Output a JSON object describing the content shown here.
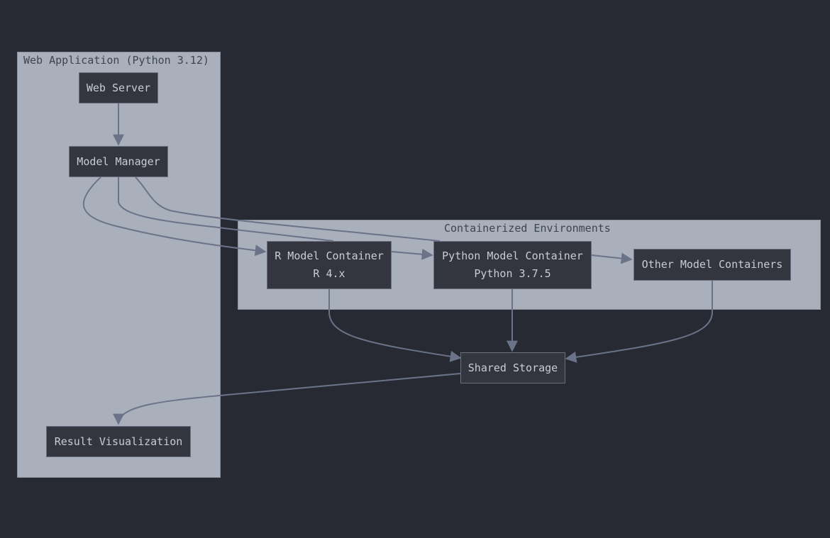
{
  "clusters": {
    "web_app": {
      "label": "Web Application (Python 3.12)"
    },
    "containers": {
      "label": "Containerized Environments"
    }
  },
  "nodes": {
    "web_server": {
      "label": "Web Server"
    },
    "model_manager": {
      "label": "Model Manager"
    },
    "r_container": {
      "label": "R Model Container",
      "sub": "R 4.x"
    },
    "python_container": {
      "label": "Python Model Container",
      "sub": "Python 3.7.5"
    },
    "other_containers": {
      "label": "Other Model Containers"
    },
    "shared_storage": {
      "label": "Shared Storage"
    },
    "result_viz": {
      "label": "Result Visualization"
    }
  },
  "edges": [
    {
      "from": "Web Server",
      "to": "Model Manager"
    },
    {
      "from": "Model Manager",
      "to": "R Model Container"
    },
    {
      "from": "Model Manager",
      "to": "Python Model Container"
    },
    {
      "from": "Model Manager",
      "to": "Other Model Containers"
    },
    {
      "from": "R Model Container",
      "to": "Python Model Container"
    },
    {
      "from": "Python Model Container",
      "to": "Other Model Containers"
    },
    {
      "from": "R Model Container",
      "to": "Shared Storage"
    },
    {
      "from": "Python Model Container",
      "to": "Shared Storage"
    },
    {
      "from": "Other Model Containers",
      "to": "Shared Storage"
    },
    {
      "from": "Shared Storage",
      "to": "Result Visualization"
    }
  ],
  "colors": {
    "background": "#282a33",
    "cluster_fill": "#a9b0bc",
    "node_fill": "#33363f",
    "node_text": "#c8ccd4",
    "edge": "#6b7389"
  }
}
